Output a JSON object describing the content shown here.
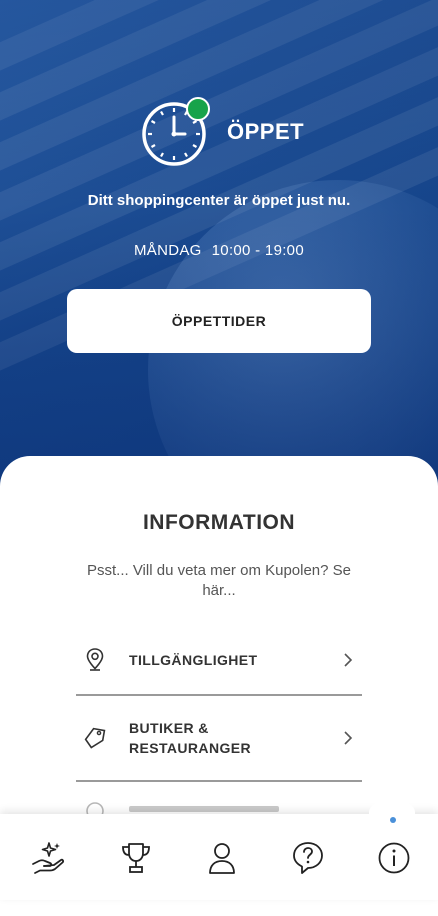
{
  "status": {
    "title": "ÖPPET",
    "message": "Ditt shoppingcenter är öppet just nu.",
    "day": "MÅNDAG",
    "hours": "10:00 - 19:00",
    "indicator_color": "#17a34a",
    "icon": "clock-icon"
  },
  "hours_button": {
    "label": "ÖPPETTIDER"
  },
  "information": {
    "title": "INFORMATION",
    "subtitle": "Psst... Vill du veta mer om Kupolen? Se här...",
    "items": [
      {
        "label": "TILLGÄNGLIGHET",
        "icon": "location-pin-icon"
      },
      {
        "label": "BUTIKER & RESTAURANGER",
        "icon": "tag-icon"
      }
    ]
  },
  "nav": {
    "items": [
      {
        "icon": "hand-sparkle-icon"
      },
      {
        "icon": "trophy-icon"
      },
      {
        "icon": "person-icon"
      },
      {
        "icon": "question-icon"
      },
      {
        "icon": "info-icon",
        "active": true
      }
    ],
    "active_color": "#4a90d9"
  }
}
